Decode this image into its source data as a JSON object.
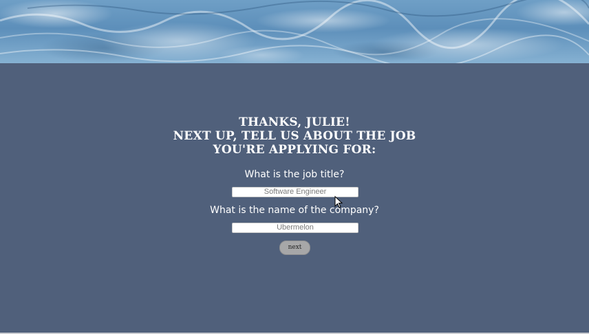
{
  "heading": {
    "line1": "THANKS, JULIE!",
    "line2": "NEXT UP, TELL US ABOUT THE JOB",
    "line3": "YOU'RE APPLYING FOR:"
  },
  "job_title": {
    "question": "What is the job title?",
    "value": "Software Engineer"
  },
  "company": {
    "question": "What is the name of the company?",
    "value": "Ubermelon"
  },
  "next_button": {
    "label": "next"
  },
  "colors": {
    "background": "#50607b",
    "text": "#ffffff",
    "button": "#a7a7a8"
  }
}
